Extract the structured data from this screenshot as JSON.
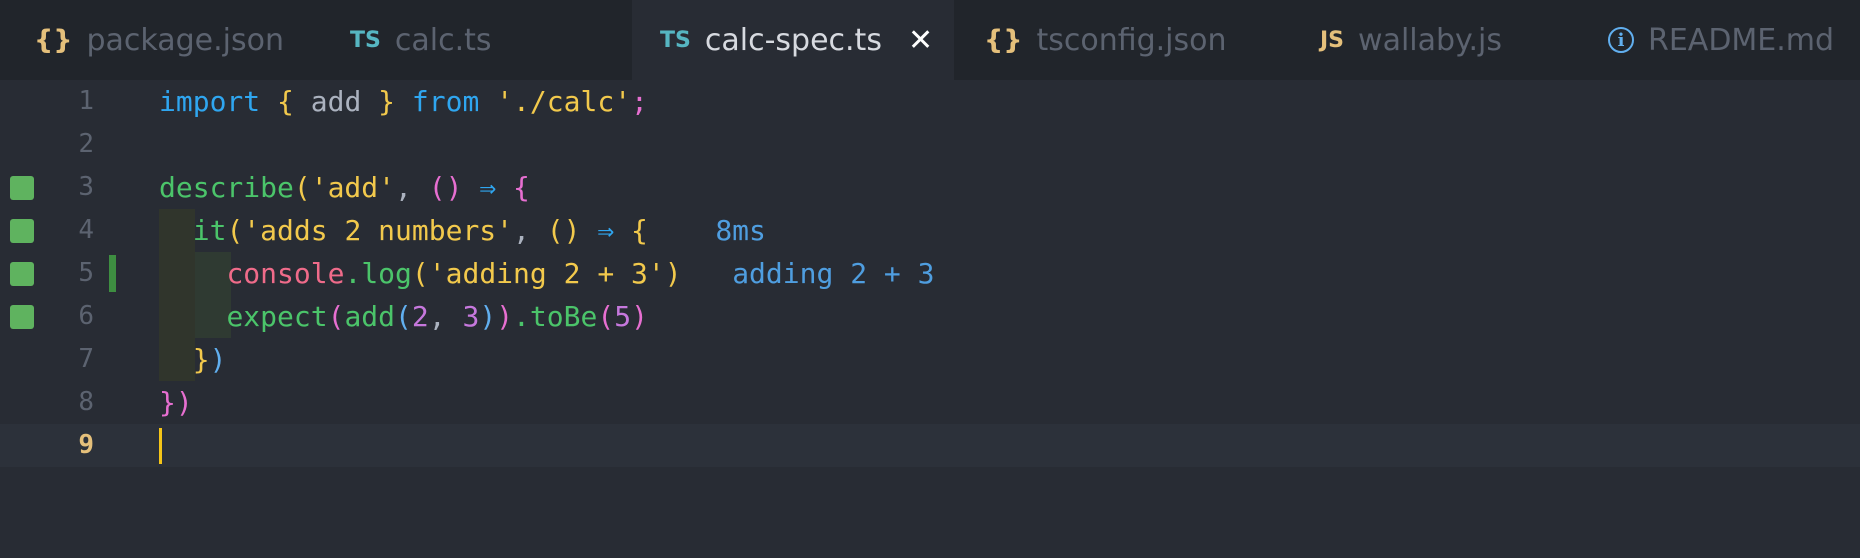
{
  "tabs": [
    {
      "icon": "json-braces-icon",
      "icon_text": "{}",
      "label": "package.json",
      "active": false
    },
    {
      "icon": "typescript-icon",
      "icon_text": "TS",
      "label": "calc.ts",
      "active": false
    },
    {
      "icon": "typescript-icon",
      "icon_text": "TS",
      "label": "calc-spec.ts",
      "active": true,
      "close": "✕"
    },
    {
      "icon": "json-braces-icon",
      "icon_text": "{}",
      "label": "tsconfig.json",
      "active": false
    },
    {
      "icon": "javascript-icon",
      "icon_text": "JS",
      "label": "wallaby.js",
      "active": false
    },
    {
      "icon": "info-icon",
      "icon_text": "i",
      "label": "README.md",
      "active": false
    }
  ],
  "line_numbers": [
    "1",
    "2",
    "3",
    "4",
    "5",
    "6",
    "7",
    "8",
    "9"
  ],
  "current_line": "9",
  "code": {
    "l1": {
      "import": "import",
      "ob": "{",
      "name": " add ",
      "cb": "}",
      "from": "from",
      "path": "'./calc'",
      "semi": ";"
    },
    "l3": {
      "fn": "describe",
      "op": "(",
      "str": "'add'",
      "comma": ", ",
      "paren": "()",
      "arrow": "⇒",
      "ob": "{"
    },
    "l4": {
      "fn": "it",
      "op": "(",
      "str": "'adds 2 numbers'",
      "comma": ", ",
      "paren": "()",
      "arrow": "⇒",
      "ob": "{"
    },
    "l5": {
      "obj": "console",
      "dot": ".",
      "fn": "log",
      "op": "(",
      "str": "'adding 2 + 3'",
      "cp": ")"
    },
    "l6": {
      "fn": "expect",
      "op": "(",
      "fn2": "add",
      "op2": "(",
      "n1": "2",
      "comma": ", ",
      "n2": "3",
      "cp2": ")",
      "cp": ")",
      "dot": ".",
      "fn3": "toBe",
      "op3": "(",
      "n3": "5",
      "cp3": ")"
    },
    "l7": {
      "cb": "}",
      "cp": ")"
    },
    "l8": {
      "cb": "}",
      "cp": ")"
    }
  },
  "inline_annotations": {
    "l4": "8ms",
    "l5": "adding 2 + 3"
  },
  "colors": {
    "coverage_covered": "#5fb35f",
    "cursor": "#f5c518",
    "background": "#282c34"
  }
}
